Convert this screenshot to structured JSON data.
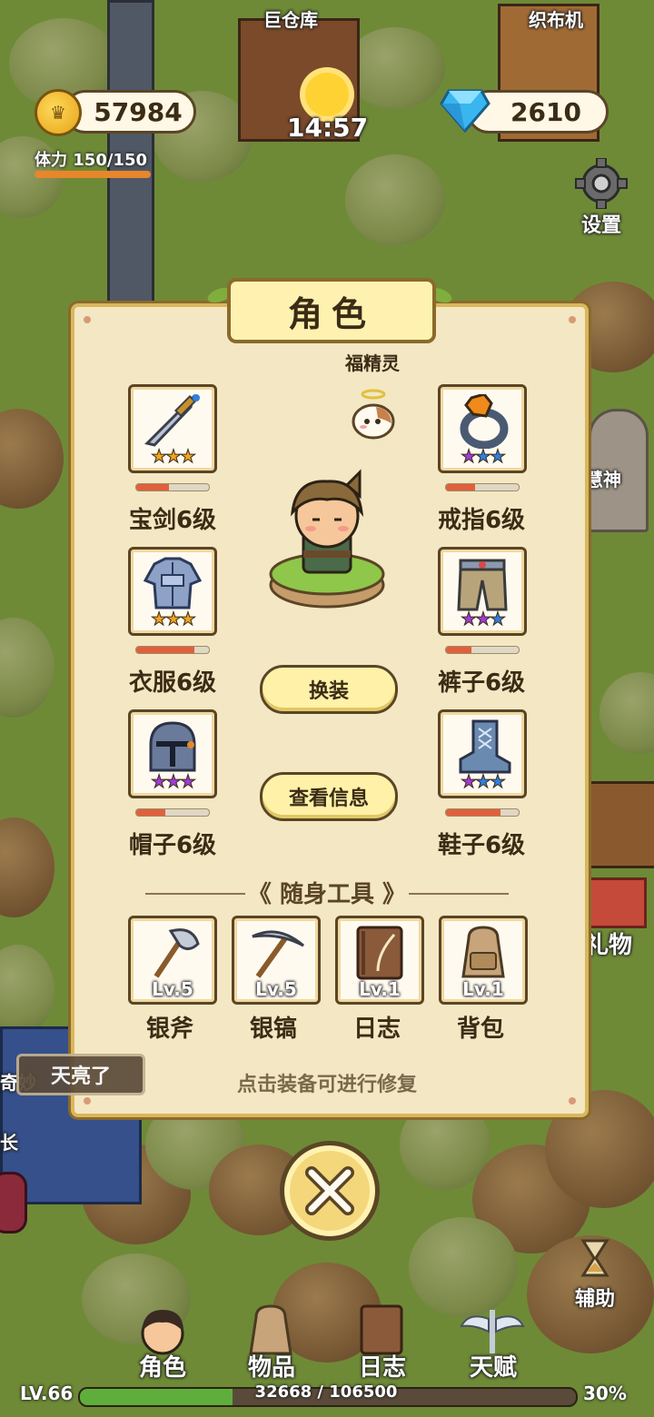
{
  "places": {
    "barn": "巨仓库",
    "loom": "织布机",
    "wisdom_god": "慧神",
    "gift": "礼物",
    "wonder": "奇妙",
    "chief": "长"
  },
  "hud": {
    "coins": "57984",
    "gems": "2610",
    "stamina_text": "体力 150/150",
    "stamina_fraction": 1.0,
    "time": "14:57",
    "settings_label": "设置",
    "assist_label": "辅助"
  },
  "panel": {
    "title": "角色",
    "pet_name": "福精灵",
    "change_outfit": "换装",
    "view_info": "查看信息",
    "equipment": [
      {
        "label": "宝剑6级",
        "icon": "sword-icon",
        "stars": [
          "gold",
          "gold",
          "gold"
        ],
        "durability": 0.45
      },
      {
        "label": "戒指6级",
        "icon": "ring-icon",
        "stars": [
          "purple",
          "blue",
          "blue"
        ],
        "durability": 0.4
      },
      {
        "label": "衣服6级",
        "icon": "armor-icon",
        "stars": [
          "gold",
          "gold",
          "gold"
        ],
        "durability": 0.8
      },
      {
        "label": "裤子6级",
        "icon": "pants-icon",
        "stars": [
          "purple",
          "purple",
          "blue"
        ],
        "durability": 0.35
      },
      {
        "label": "帽子6级",
        "icon": "helmet-icon",
        "stars": [
          "purple",
          "purple",
          "purple"
        ],
        "durability": 0.4
      },
      {
        "label": "鞋子6级",
        "icon": "boot-icon",
        "stars": [
          "purple",
          "blue",
          "blue"
        ],
        "durability": 0.75
      }
    ],
    "tools_title": "随身工具",
    "tools": [
      {
        "name": "银斧",
        "level": "Lv.5",
        "icon": "axe-icon"
      },
      {
        "name": "银镐",
        "level": "Lv.5",
        "icon": "pickaxe-icon"
      },
      {
        "name": "日志",
        "level": "Lv.1",
        "icon": "journal-icon"
      },
      {
        "name": "背包",
        "level": "Lv.1",
        "icon": "backpack-icon"
      }
    ],
    "hint": "点击装备可进行修复"
  },
  "daybreak_label": "天亮了",
  "nav": [
    {
      "label": "角色",
      "icon": "character-icon"
    },
    {
      "label": "物品",
      "icon": "items-bag-icon"
    },
    {
      "label": "日志",
      "icon": "journal-icon"
    },
    {
      "label": "天赋",
      "icon": "talent-wings-icon"
    }
  ],
  "player": {
    "level": "LV.66",
    "xp_text": "32668 / 106500",
    "xp_percent": "30%",
    "xp_fraction": 0.307
  },
  "colors": {
    "star_gold": "#f2a41f",
    "star_purple": "#a23cd8",
    "star_blue": "#2f7fe0"
  }
}
